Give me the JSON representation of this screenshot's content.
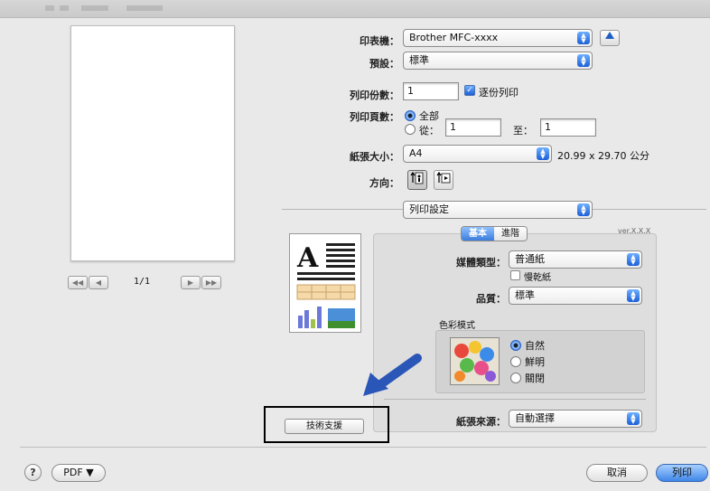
{
  "colors": {
    "accent": "#2f74dd",
    "highlight_box": "#000000",
    "arrow": "#2a56b8"
  },
  "preview": {
    "page_indicator": "1/1"
  },
  "printer": {
    "label": "印表機：",
    "value": "Brother MFC-xxxx"
  },
  "presets": {
    "label": "預設：",
    "value": "標準"
  },
  "copies": {
    "label": "列印份數：",
    "value": "1",
    "collate_label": "逐份列印",
    "collate_checked": true
  },
  "pages": {
    "label": "列印頁數：",
    "all_label": "全部",
    "from_label": "從：",
    "from_value": "1",
    "to_label": "至：",
    "to_value": "1"
  },
  "paper_size": {
    "label": "紙張大小：",
    "value": "A4",
    "dimensions": "20.99 x 29.70 公分"
  },
  "orientation": {
    "label": "方向："
  },
  "section_popup": {
    "value": "列印設定"
  },
  "tabs": {
    "basic": "基本",
    "advanced": "進階"
  },
  "version": "ver.X.X.X",
  "media": {
    "label": "媒體類型：",
    "value": "普通紙",
    "slow_dry_label": "慢乾紙"
  },
  "quality": {
    "label": "品質：",
    "value": "標準"
  },
  "color_mode": {
    "label": "色彩模式",
    "options": [
      "自然",
      "鮮明",
      "關閉"
    ]
  },
  "paper_source": {
    "label": "紙張來源：",
    "value": "自動選擇"
  },
  "support_button": "技術支援",
  "footer": {
    "help": "?",
    "pdf": "PDF ▼",
    "cancel": "取消",
    "print": "列印"
  },
  "icons": [
    "arrow-up-icon",
    "portrait-icon",
    "landscape-icon",
    "popup-arrows-icon",
    "nav-first-icon",
    "nav-prev-icon",
    "nav-next-icon",
    "nav-last-icon",
    "pointer-arrow-icon"
  ]
}
